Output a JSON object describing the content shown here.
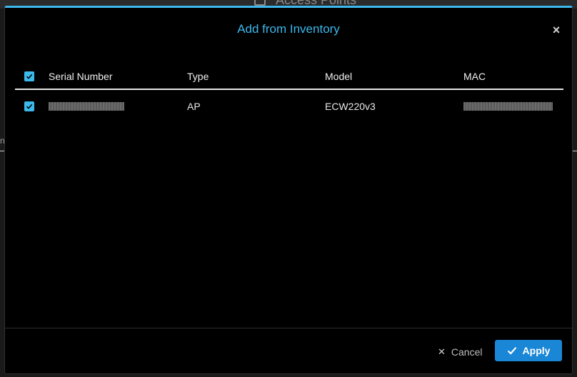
{
  "background": {
    "title": "Access Points",
    "edge_char": "n"
  },
  "modal": {
    "title": "Add from Inventory",
    "close_glyph": "×"
  },
  "table": {
    "columns": [
      "Serial Number",
      "Type",
      "Model",
      "MAC"
    ],
    "rows": [
      {
        "serial": "",
        "type": "AP",
        "model": "ECW220v3",
        "mac": "",
        "checked": true
      }
    ]
  },
  "footer": {
    "cancel_label": "Cancel",
    "apply_label": "Apply",
    "cancel_icon": "close-icon",
    "apply_icon": "checkmark-icon"
  },
  "colors": {
    "accent": "#3db8ec",
    "apply": "#1a86d6"
  }
}
